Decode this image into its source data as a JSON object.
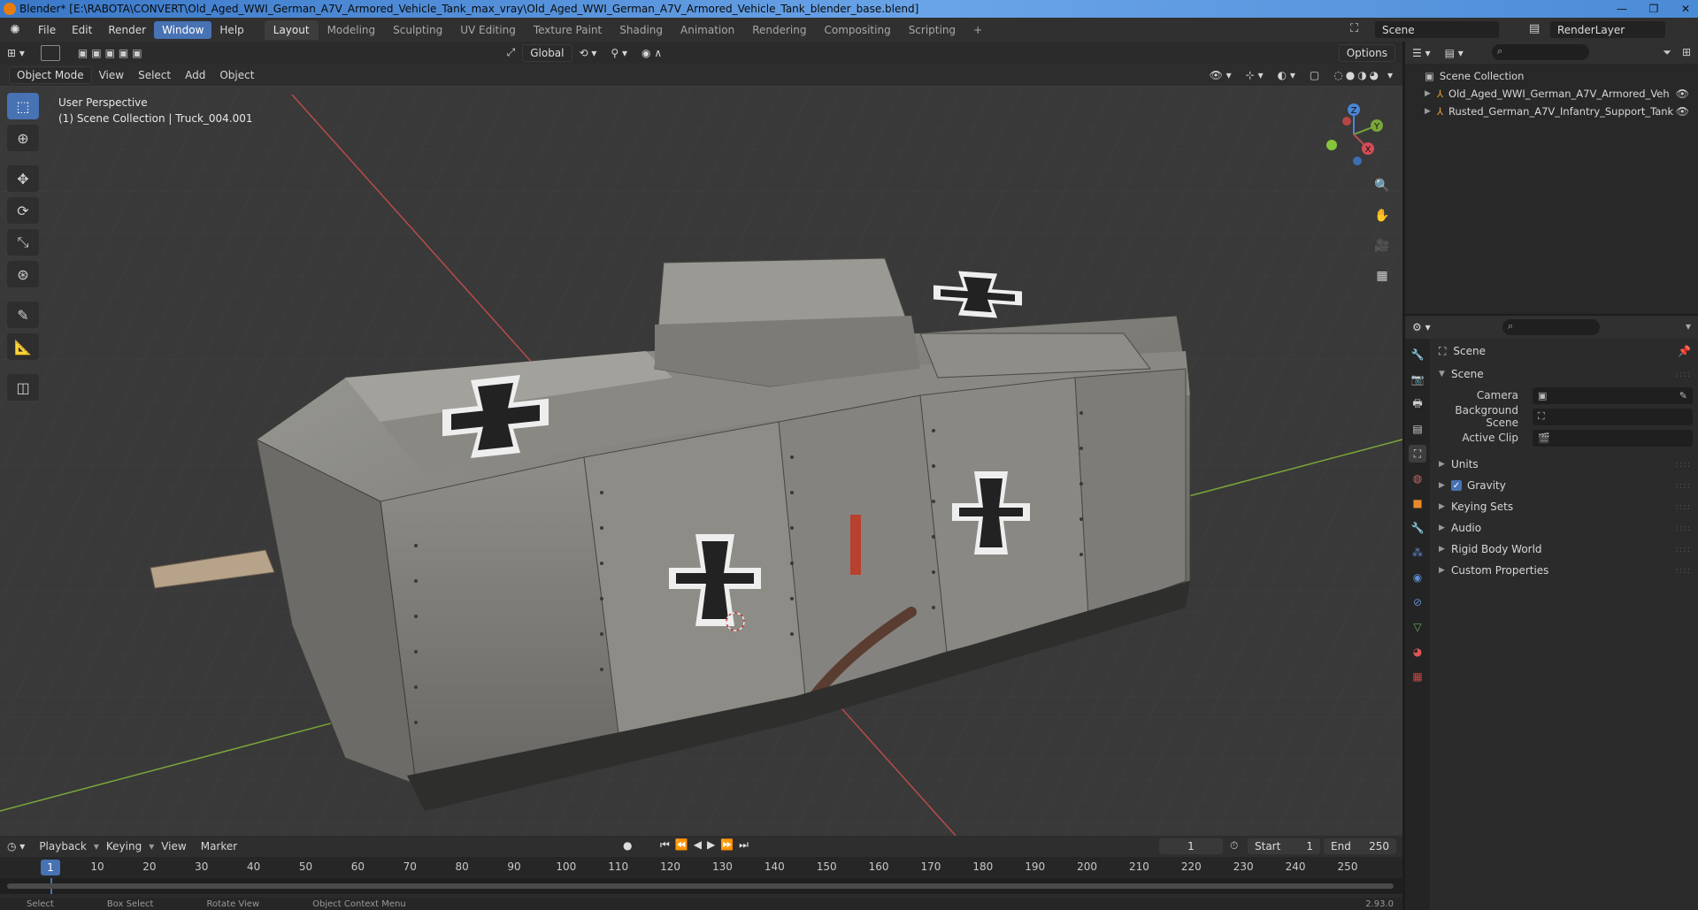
{
  "window": {
    "title": "Blender* [E:\\RABOTA\\CONVERT\\Old_Aged_WWI_German_A7V_Armored_Vehicle_Tank_max_vray\\Old_Aged_WWI_German_A7V_Armored_Vehicle_Tank_blender_base.blend]",
    "minimize": "—",
    "maximize": "❐",
    "close": "✕"
  },
  "menu": {
    "items": [
      "File",
      "Edit",
      "Render",
      "Window",
      "Help"
    ],
    "active": "Window"
  },
  "workspaces": {
    "tabs": [
      "Layout",
      "Modeling",
      "Sculpting",
      "UV Editing",
      "Texture Paint",
      "Shading",
      "Animation",
      "Rendering",
      "Compositing",
      "Scripting"
    ],
    "active": "Layout",
    "add": "+"
  },
  "scene_selector": {
    "scene": "Scene",
    "view_layer": "RenderLayer"
  },
  "viewport": {
    "transform_orientation": "Global",
    "options": "Options",
    "mode": "Object Mode",
    "menus": [
      "View",
      "Select",
      "Add",
      "Object"
    ],
    "perspective_label": "User Perspective",
    "collection_label": "(1) Scene Collection | Truck_004.001",
    "gizmo_axes": [
      "X",
      "Y",
      "Z"
    ]
  },
  "tools": [
    "select-box",
    "cursor",
    "move",
    "rotate",
    "scale",
    "transform",
    "annotate",
    "measure",
    "add-cube"
  ],
  "outliner": {
    "root": "Scene Collection",
    "items": [
      "Old_Aged_WWI_German_A7V_Armored_Veh",
      "Rusted_German_A7V_Infantry_Support_Tank"
    ]
  },
  "properties": {
    "context": "Scene",
    "panel": "Scene",
    "fields": [
      {
        "label": "Camera",
        "value": ""
      },
      {
        "label": "Background Scene",
        "value": ""
      },
      {
        "label": "Active Clip",
        "value": ""
      }
    ],
    "subpanels": [
      "Units",
      "Gravity",
      "Keying Sets",
      "Audio",
      "Rigid Body World",
      "Custom Properties"
    ],
    "gravity_checked": true
  },
  "timeline": {
    "menus": [
      "Playback",
      "Keying",
      "View",
      "Marker"
    ],
    "current_frame": "1",
    "start_label": "Start",
    "start": "1",
    "end_label": "End",
    "end": "250",
    "ticks": [
      10,
      20,
      30,
      40,
      50,
      60,
      70,
      80,
      90,
      100,
      110,
      120,
      130,
      140,
      150,
      160,
      170,
      180,
      190,
      200,
      210,
      220,
      230,
      240,
      250
    ],
    "playhead": "1"
  },
  "status_bar": {
    "items": [
      "Select",
      "Box Select",
      "Rotate View",
      "Object Context Menu"
    ],
    "version": "2.93.0"
  },
  "colors": {
    "accent": "#4772b3",
    "x_axis": "#b84b4b",
    "y_axis": "#7aa63a",
    "z_axis": "#4b86d6",
    "background": "#393939"
  }
}
